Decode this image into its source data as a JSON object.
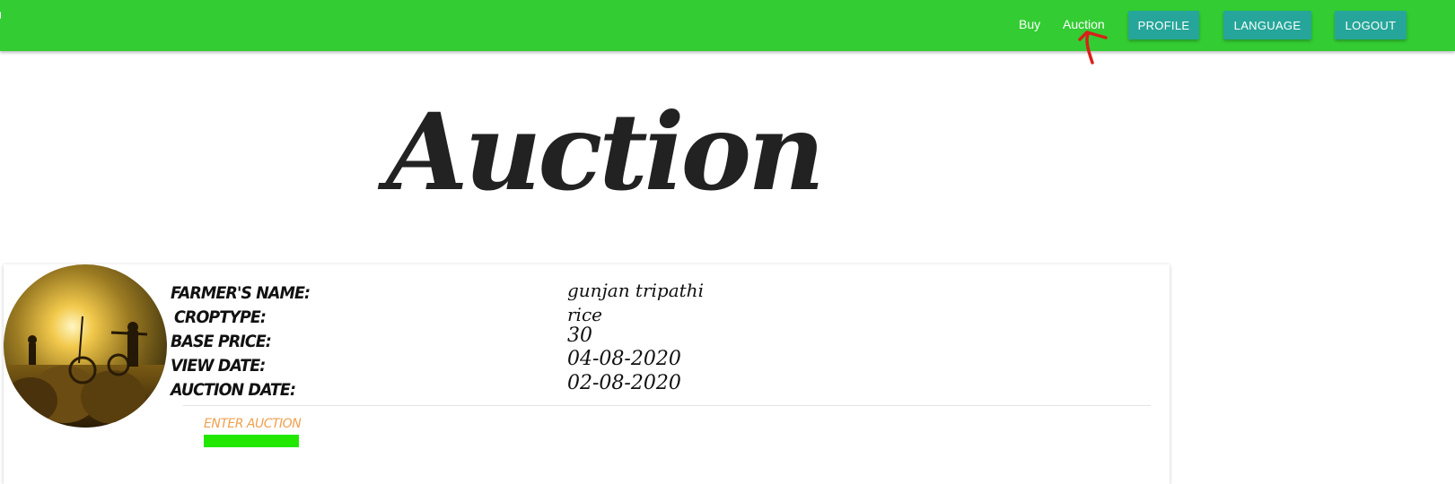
{
  "nav": {
    "links": {
      "buy": "Buy",
      "auction": "Auction"
    },
    "buttons": {
      "profile": "PROFILE",
      "language": "LANGUAGE",
      "logout": "LOGOUT"
    }
  },
  "page": {
    "title": "Auction"
  },
  "card": {
    "labels": {
      "farmer_name": "FARMER'S NAME:",
      "crop_type": "CROPTYPE:",
      "base_price": "BASE PRICE:",
      "view_date": "VIEW DATE:",
      "auction_date": "AUCTION DATE:"
    },
    "values": {
      "farmer_name": "gunjan tripathi",
      "crop_type": "rice",
      "base_price": "30",
      "view_date": "04-08-2020",
      "auction_date": "02-08-2020"
    },
    "enter_auction": "ENTER AUCTION"
  },
  "colors": {
    "navbar": "#33cc33",
    "button": "#26a69a",
    "enter_link": "#f0a050",
    "enter_bar": "#22e800",
    "annotation": "#d9201a"
  },
  "icons": {
    "annotation": "red-arrow-annotation-icon"
  }
}
